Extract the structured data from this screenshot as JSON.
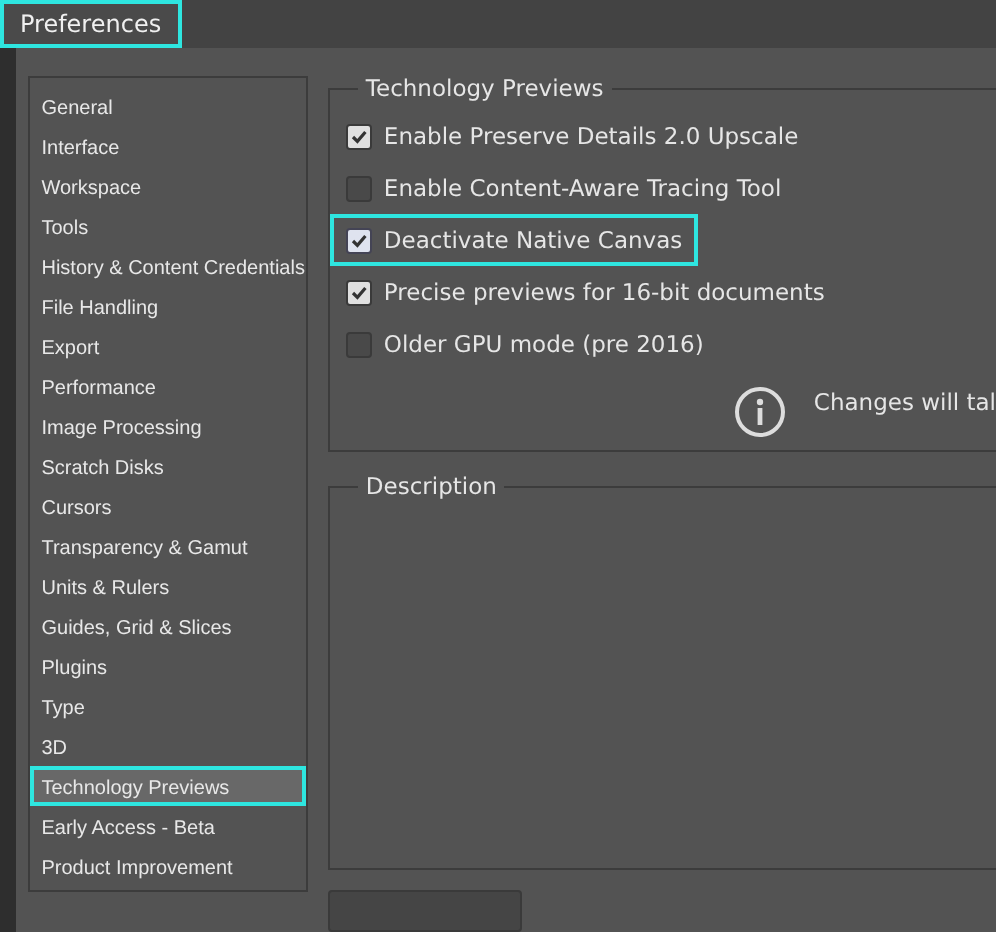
{
  "window": {
    "title": "Preferences",
    "highlighted": true
  },
  "sidebar": {
    "items": [
      {
        "label": "General",
        "selected": false,
        "highlighted": false
      },
      {
        "label": "Interface",
        "selected": false,
        "highlighted": false
      },
      {
        "label": "Workspace",
        "selected": false,
        "highlighted": false
      },
      {
        "label": "Tools",
        "selected": false,
        "highlighted": false
      },
      {
        "label": "History & Content Credentials",
        "selected": false,
        "highlighted": false
      },
      {
        "label": "File Handling",
        "selected": false,
        "highlighted": false
      },
      {
        "label": "Export",
        "selected": false,
        "highlighted": false
      },
      {
        "label": "Performance",
        "selected": false,
        "highlighted": false
      },
      {
        "label": "Image Processing",
        "selected": false,
        "highlighted": false
      },
      {
        "label": "Scratch Disks",
        "selected": false,
        "highlighted": false
      },
      {
        "label": "Cursors",
        "selected": false,
        "highlighted": false
      },
      {
        "label": "Transparency & Gamut",
        "selected": false,
        "highlighted": false
      },
      {
        "label": "Units & Rulers",
        "selected": false,
        "highlighted": false
      },
      {
        "label": "Guides, Grid & Slices",
        "selected": false,
        "highlighted": false
      },
      {
        "label": "Plugins",
        "selected": false,
        "highlighted": false
      },
      {
        "label": "Type",
        "selected": false,
        "highlighted": false
      },
      {
        "label": "3D",
        "selected": false,
        "highlighted": false
      },
      {
        "label": "Technology Previews",
        "selected": true,
        "highlighted": true
      },
      {
        "label": "Early Access - Beta",
        "selected": false,
        "highlighted": false
      },
      {
        "label": "Product Improvement",
        "selected": false,
        "highlighted": false
      }
    ]
  },
  "technology_previews": {
    "title": "Technology Previews",
    "options": [
      {
        "label": "Enable Preserve Details 2.0 Upscale",
        "checked": true,
        "highlighted": false
      },
      {
        "label": "Enable Content-Aware Tracing Tool",
        "checked": false,
        "highlighted": false
      },
      {
        "label": "Deactivate Native Canvas",
        "checked": true,
        "highlighted": true
      },
      {
        "label": "Precise previews for 16-bit documents",
        "checked": true,
        "highlighted": false
      },
      {
        "label": "Older GPU mode (pre 2016)",
        "checked": false,
        "highlighted": false
      }
    ],
    "note": "Changes will tal"
  },
  "description": {
    "title": "Description"
  }
}
